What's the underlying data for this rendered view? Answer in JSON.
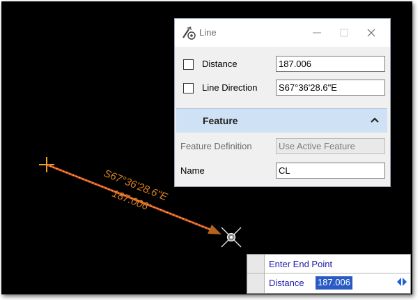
{
  "canvas": {
    "bearing_label": "S67°36'28.6\"E",
    "distance_label": "187.006'"
  },
  "dialog": {
    "title": "Line",
    "icon": "line-tool-icon",
    "controls": [
      "minimize-icon",
      "maximize-icon",
      "close-icon"
    ],
    "distance": {
      "label": "Distance",
      "value": "187.006",
      "checked": false
    },
    "line_direction": {
      "label": "Line Direction",
      "value": "S67°36'28.6\"E",
      "checked": false
    },
    "feature_section": {
      "title": "Feature",
      "expanded": true,
      "feature_definition": {
        "label": "Feature Definition",
        "value": "Use Active Feature",
        "disabled": true
      },
      "name": {
        "label": "Name",
        "value": "CL"
      }
    }
  },
  "prompt": {
    "message": "Enter End Point",
    "field_label": "Distance",
    "field_value": "187.006"
  },
  "colors": {
    "canvas_bg": "#000000",
    "line": "#d9571e",
    "dim_text": "#d9821e",
    "section_header": "#cfe1f5",
    "selection": "#2a5ac4",
    "prompt_text": "#1a1aa6"
  }
}
